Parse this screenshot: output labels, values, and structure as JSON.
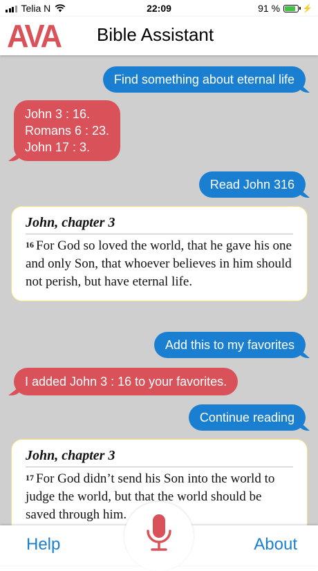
{
  "status_bar": {
    "carrier": "Telia N",
    "time": "22:09",
    "battery_text": "91 %",
    "battery_level": 0.91,
    "charging_symbol": "⚡"
  },
  "header": {
    "logo": "AVA",
    "title": "Bible Assistant",
    "logo_color": "#d9525a"
  },
  "colors": {
    "user_bubble": "#1a7fd1",
    "ava_bubble": "#d9525a",
    "chat_background": "#cfcfcf",
    "card_border": "#f2e27c"
  },
  "messages": {
    "m1": "Find something about eternal life",
    "m2_lines": [
      "John 3 : 16.",
      "Romans 6 : 23.",
      "John 17 : 3."
    ],
    "m3": "Read John 316",
    "card1": {
      "title": "John, chapter 3",
      "verse": "16",
      "text": "For God so loved the world, that he gave his one and only Son, that whoever believes in him should not perish, but have eternal life."
    },
    "m4": "Add this to my favorites",
    "m5": "I added John 3 : 16 to your favorites.",
    "m6": "Continue reading",
    "card2": {
      "title": "John, chapter 3",
      "verse": "17",
      "text": "For God didn’t send his Son into the world to judge the world, but that the world should be saved through him."
    }
  },
  "bottom_bar": {
    "help": "Help",
    "about": "About",
    "mic_icon": "microphone-icon"
  }
}
